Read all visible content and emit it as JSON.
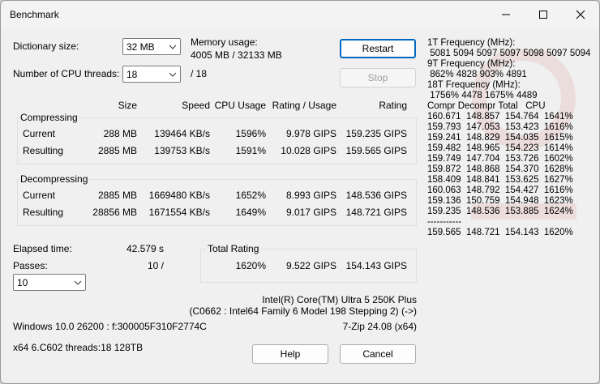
{
  "window": {
    "title": "Benchmark"
  },
  "settings": {
    "dict_label": "Dictionary size:",
    "dict_value": "32 MB",
    "threads_label": "Number of CPU threads:",
    "threads_value": "18",
    "threads_max": "/ 18",
    "mem_label": "Memory usage:",
    "mem_value": "4005 MB / 32133 MB"
  },
  "buttons": {
    "restart": "Restart",
    "stop": "Stop",
    "help": "Help",
    "cancel": "Cancel"
  },
  "table": {
    "headers": {
      "size": "Size",
      "speed": "Speed",
      "cpu": "CPU Usage",
      "ru": "Rating / Usage",
      "rating": "Rating"
    },
    "compressing": {
      "label": "Compressing",
      "current": {
        "label": "Current",
        "size": "288 MB",
        "speed": "139464 KB/s",
        "cpu": "1596%",
        "ru": "9.978 GIPS",
        "rating": "159.235 GIPS"
      },
      "resulting": {
        "label": "Resulting",
        "size": "2885 MB",
        "speed": "139753 KB/s",
        "cpu": "1591%",
        "ru": "10.028 GIPS",
        "rating": "159.565 GIPS"
      }
    },
    "decompressing": {
      "label": "Decompressing",
      "current": {
        "label": "Current",
        "size": "2885 MB",
        "speed": "1669480 KB/s",
        "cpu": "1652%",
        "ru": "8.993 GIPS",
        "rating": "148.536 GIPS"
      },
      "resulting": {
        "label": "Resulting",
        "size": "28856 MB",
        "speed": "1671554 KB/s",
        "cpu": "1649%",
        "ru": "9.017 GIPS",
        "rating": "148.721 GIPS"
      }
    }
  },
  "elapsed": {
    "label": "Elapsed time:",
    "value": "42.579 s"
  },
  "passes": {
    "label": "Passes:",
    "value": "10 /",
    "select_value": "10"
  },
  "total": {
    "label": "Total Rating",
    "cpu": "1620%",
    "ru": "9.522 GIPS",
    "rating": "154.143 GIPS"
  },
  "cpu_info": {
    "name": "Intel(R) Core(TM) Ultra 5 250K Plus",
    "details": "(C0662 : Intel64 Family 6 Model 198 Stepping 2) (->)"
  },
  "system": {
    "os": "Windows 10.0 26200 : f:300005F310F2774C",
    "version": "7-Zip 24.08 (x64)",
    "arch": "x64 6.C602 threads:18 128TB"
  },
  "log_lines": [
    "1T Frequency (MHz):",
    " 5081 5094 5097 5097 5098 5097 5094",
    "9T Frequency (MHz):",
    " 862% 4828 903% 4891",
    "18T Frequency (MHz):",
    " 1756% 4478 1675% 4489",
    "Compr Decompr Total   CPU",
    "160.671  148.857  154.764  1641%",
    "159.793  147.053  153.423  1616%",
    "159.241  148.829  154.035  1615%",
    "159.482  148.965  154.223  1614%",
    "159.749  147.704  153.726  1602%",
    "159.872  148.868  154.370  1628%",
    "158.409  148.841  153.625  1627%",
    "160.063  148.792  154.427  1616%",
    "159.136  150.759  154.948  1623%",
    "159.235  148.536  153.885  1624%",
    "-----------",
    "159.565  148.721  154.143  1620%"
  ]
}
